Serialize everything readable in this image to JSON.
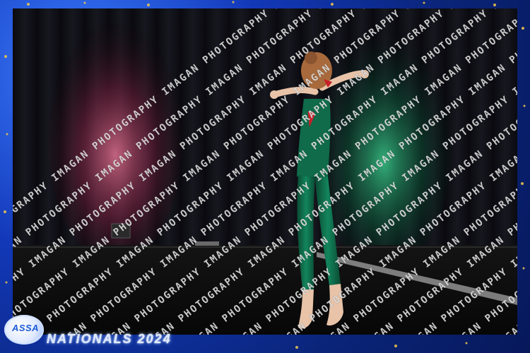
{
  "event": {
    "title": "NATIONALS 2024",
    "logo_text": "ASSA"
  },
  "watermark": {
    "text": "IMAGAN PHOTOGRAPHY"
  },
  "colors": {
    "frame_blue": "#1238b8",
    "pink_light": "#e06a8f",
    "green_light": "#2fb37a",
    "leotard_green": "#0f6b4a"
  }
}
